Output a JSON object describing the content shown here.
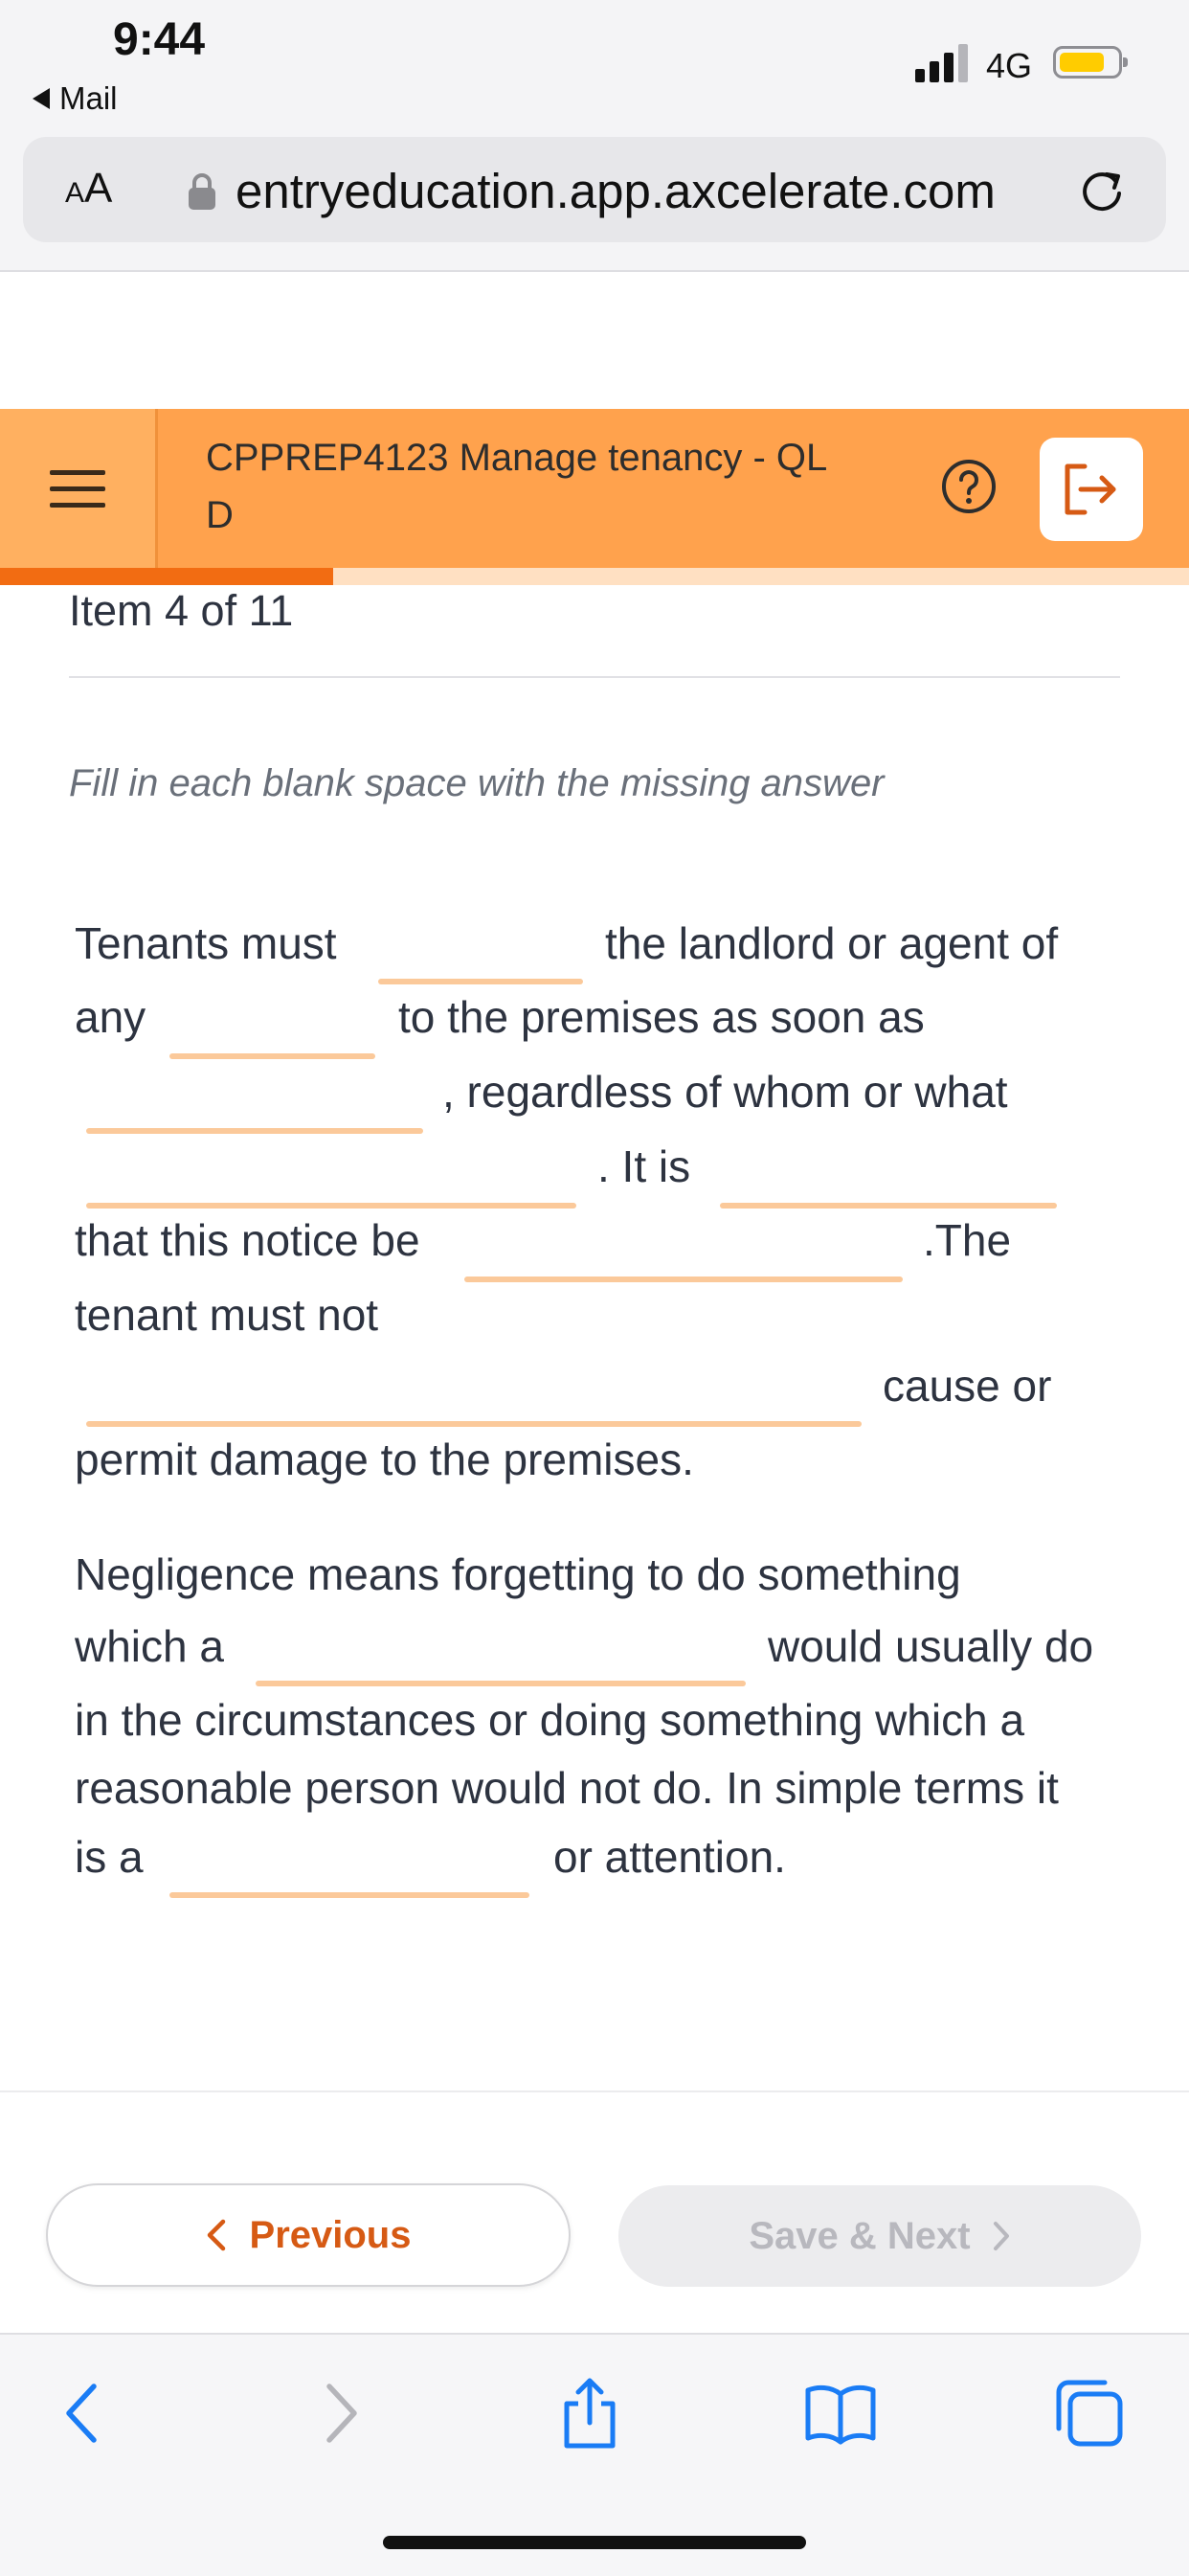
{
  "status_bar": {
    "time": "9:44",
    "back_app": "Mail",
    "network": "4G"
  },
  "browser": {
    "text_size": "AA",
    "url": "entryeducation.app.axcelerate.com"
  },
  "header": {
    "title": "CPPREP4123 Manage tenancy - QL D",
    "title_line1": "CPPREP4123 Manage tenancy - QL",
    "title_line2": "D",
    "progress": 0.28
  },
  "question": {
    "counter": "Item 4 of 11",
    "instruction": "Fill in each blank space with the missing answer",
    "paragraph1": {
      "t1": "Tenants must",
      "t2": "the landlord or agent of",
      "t3": "any",
      "t4": "to the premises as soon as",
      "t5": ", regardless of whom or what",
      "t6": ". It is",
      "t7": "that this notice be",
      "t8": ".The",
      "t9": "tenant must not",
      "t10": "cause or",
      "t11": "permit damage to the premises."
    },
    "paragraph2": {
      "t1": "Negligence means forgetting to do something",
      "t2": "which a",
      "t3": "would usually do",
      "t4": "in the circumstances or doing something which a",
      "t5": "reasonable person would not do. In simple terms it",
      "t6": "is a",
      "t7": "or attention."
    }
  },
  "footer": {
    "previous_label": "Previous",
    "next_label": "Save & Next"
  },
  "colors": {
    "header": "#ffa24d",
    "accent": "#f26c12",
    "blank_line": "#fbc99a"
  }
}
